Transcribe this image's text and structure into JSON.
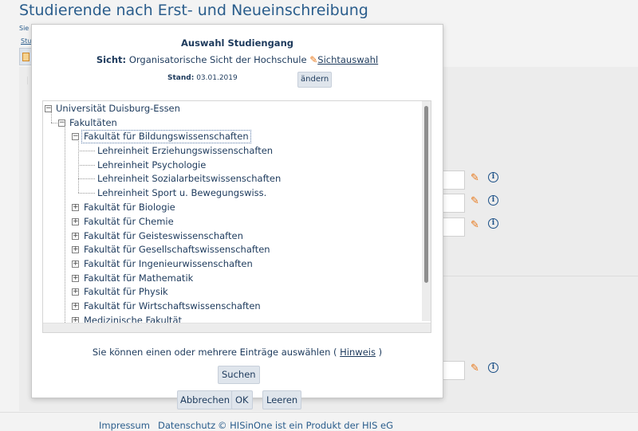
{
  "page": {
    "title": "Studierende nach Erst- und Neueinschreibung",
    "subtitle_fragment": "Sie",
    "link_fragment": "Stud"
  },
  "dialog": {
    "title": "Auswahl Studiengang",
    "view_label": "Sicht:",
    "view_value": "Organisatorische Sicht der Hochschule",
    "view_link": "Sichtauswahl",
    "stand_label": "Stand:",
    "stand_value": "03.01.2019",
    "change_button": "ändern",
    "tree": {
      "root": "Universität Duisburg-Essen",
      "level1": "Fakultäten",
      "selected": "Fakultät für Bildungswissenschaften",
      "children": [
        "Lehreinheit Erziehungswissenschaften",
        "Lehreinheit Psychologie",
        "Lehreinheit Sozialarbeitswissenschaften",
        "Lehreinheit Sport u. Bewegungswiss."
      ],
      "faculties": [
        "Fakultät für Biologie",
        "Fakultät für Chemie",
        "Fakultät für Geisteswissenschaften",
        "Fakultät für Gesellschaftswissenschaften",
        "Fakultät für Ingenieurwissenschaften",
        "Fakultät für Mathematik",
        "Fakultät für Physik",
        "Fakultät für Wirtschaftswissenschaften",
        "Medizinische Fakultät"
      ]
    },
    "hint_text_before": "Sie können einen oder mehrere Einträge auswählen (",
    "hint_link": "Hinweis",
    "hint_text_after": ")",
    "search_button": "Suchen"
  },
  "bottom_buttons": {
    "cancel": "Abbrechen",
    "ok": "OK",
    "clear": "Leeren"
  },
  "footer": {
    "impressum": "Impressum",
    "datenschutz": "Datenschutz",
    "copyright": "© HISinOne ist ein Produkt der HIS eG"
  },
  "icons": {
    "pencil": "pencil-icon",
    "info": "info-icon"
  },
  "colors": {
    "link": "#2a5d8c",
    "text": "#1d3a5c",
    "button_bg": "#dfe5ec",
    "pencil": "#e8781a"
  }
}
